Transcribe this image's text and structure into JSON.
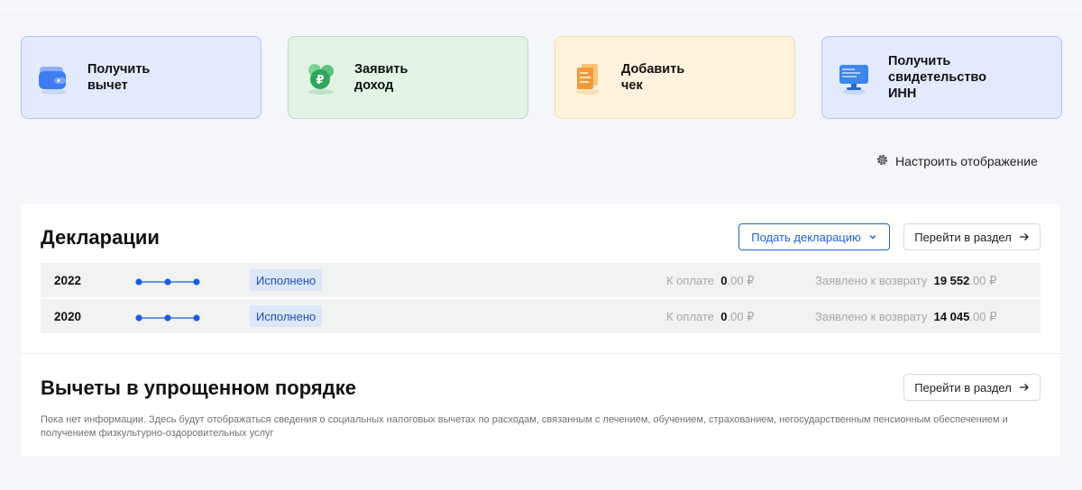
{
  "tiles": [
    {
      "label": "Получить\nвычет",
      "icon": "wallet-icon"
    },
    {
      "label": "Заявить\nдоход",
      "icon": "ruble-coins-icon"
    },
    {
      "label": "Добавить\nчек",
      "icon": "receipt-icon"
    },
    {
      "label": "Получить\nсвидетельство\nИНН",
      "icon": "monitor-icon"
    }
  ],
  "settings_label": "Настроить отображение",
  "declarations": {
    "title": "Декларации",
    "submit_button": "Подать декларацию",
    "goto_button": "Перейти в раздел",
    "pay_label": "К оплате",
    "refund_label": "Заявлено к возврату",
    "currency": "₽",
    "rows": [
      {
        "year": "2022",
        "status": "Исполнено",
        "pay_int": "0",
        "pay_dec": ".00",
        "refund_int": "19 552",
        "refund_dec": ".00"
      },
      {
        "year": "2020",
        "status": "Исполнено",
        "pay_int": "0",
        "pay_dec": ".00",
        "refund_int": "14 045",
        "refund_dec": ".00"
      }
    ]
  },
  "deductions": {
    "title": "Вычеты в упрощенном порядке",
    "goto_button": "Перейти в раздел",
    "info": "Пока нет информации. Здесь будут отображаться сведения о социальных налоговых вычетах по расходам, связанным с лечением, обучением, страхованием, негосударственным пенсионным обеспечением и получением физкультурно-оздоровительных услуг"
  },
  "colors": {
    "accent": "#1e63d5",
    "status_bg": "#dce6f9",
    "progress": "#1a5be8"
  }
}
